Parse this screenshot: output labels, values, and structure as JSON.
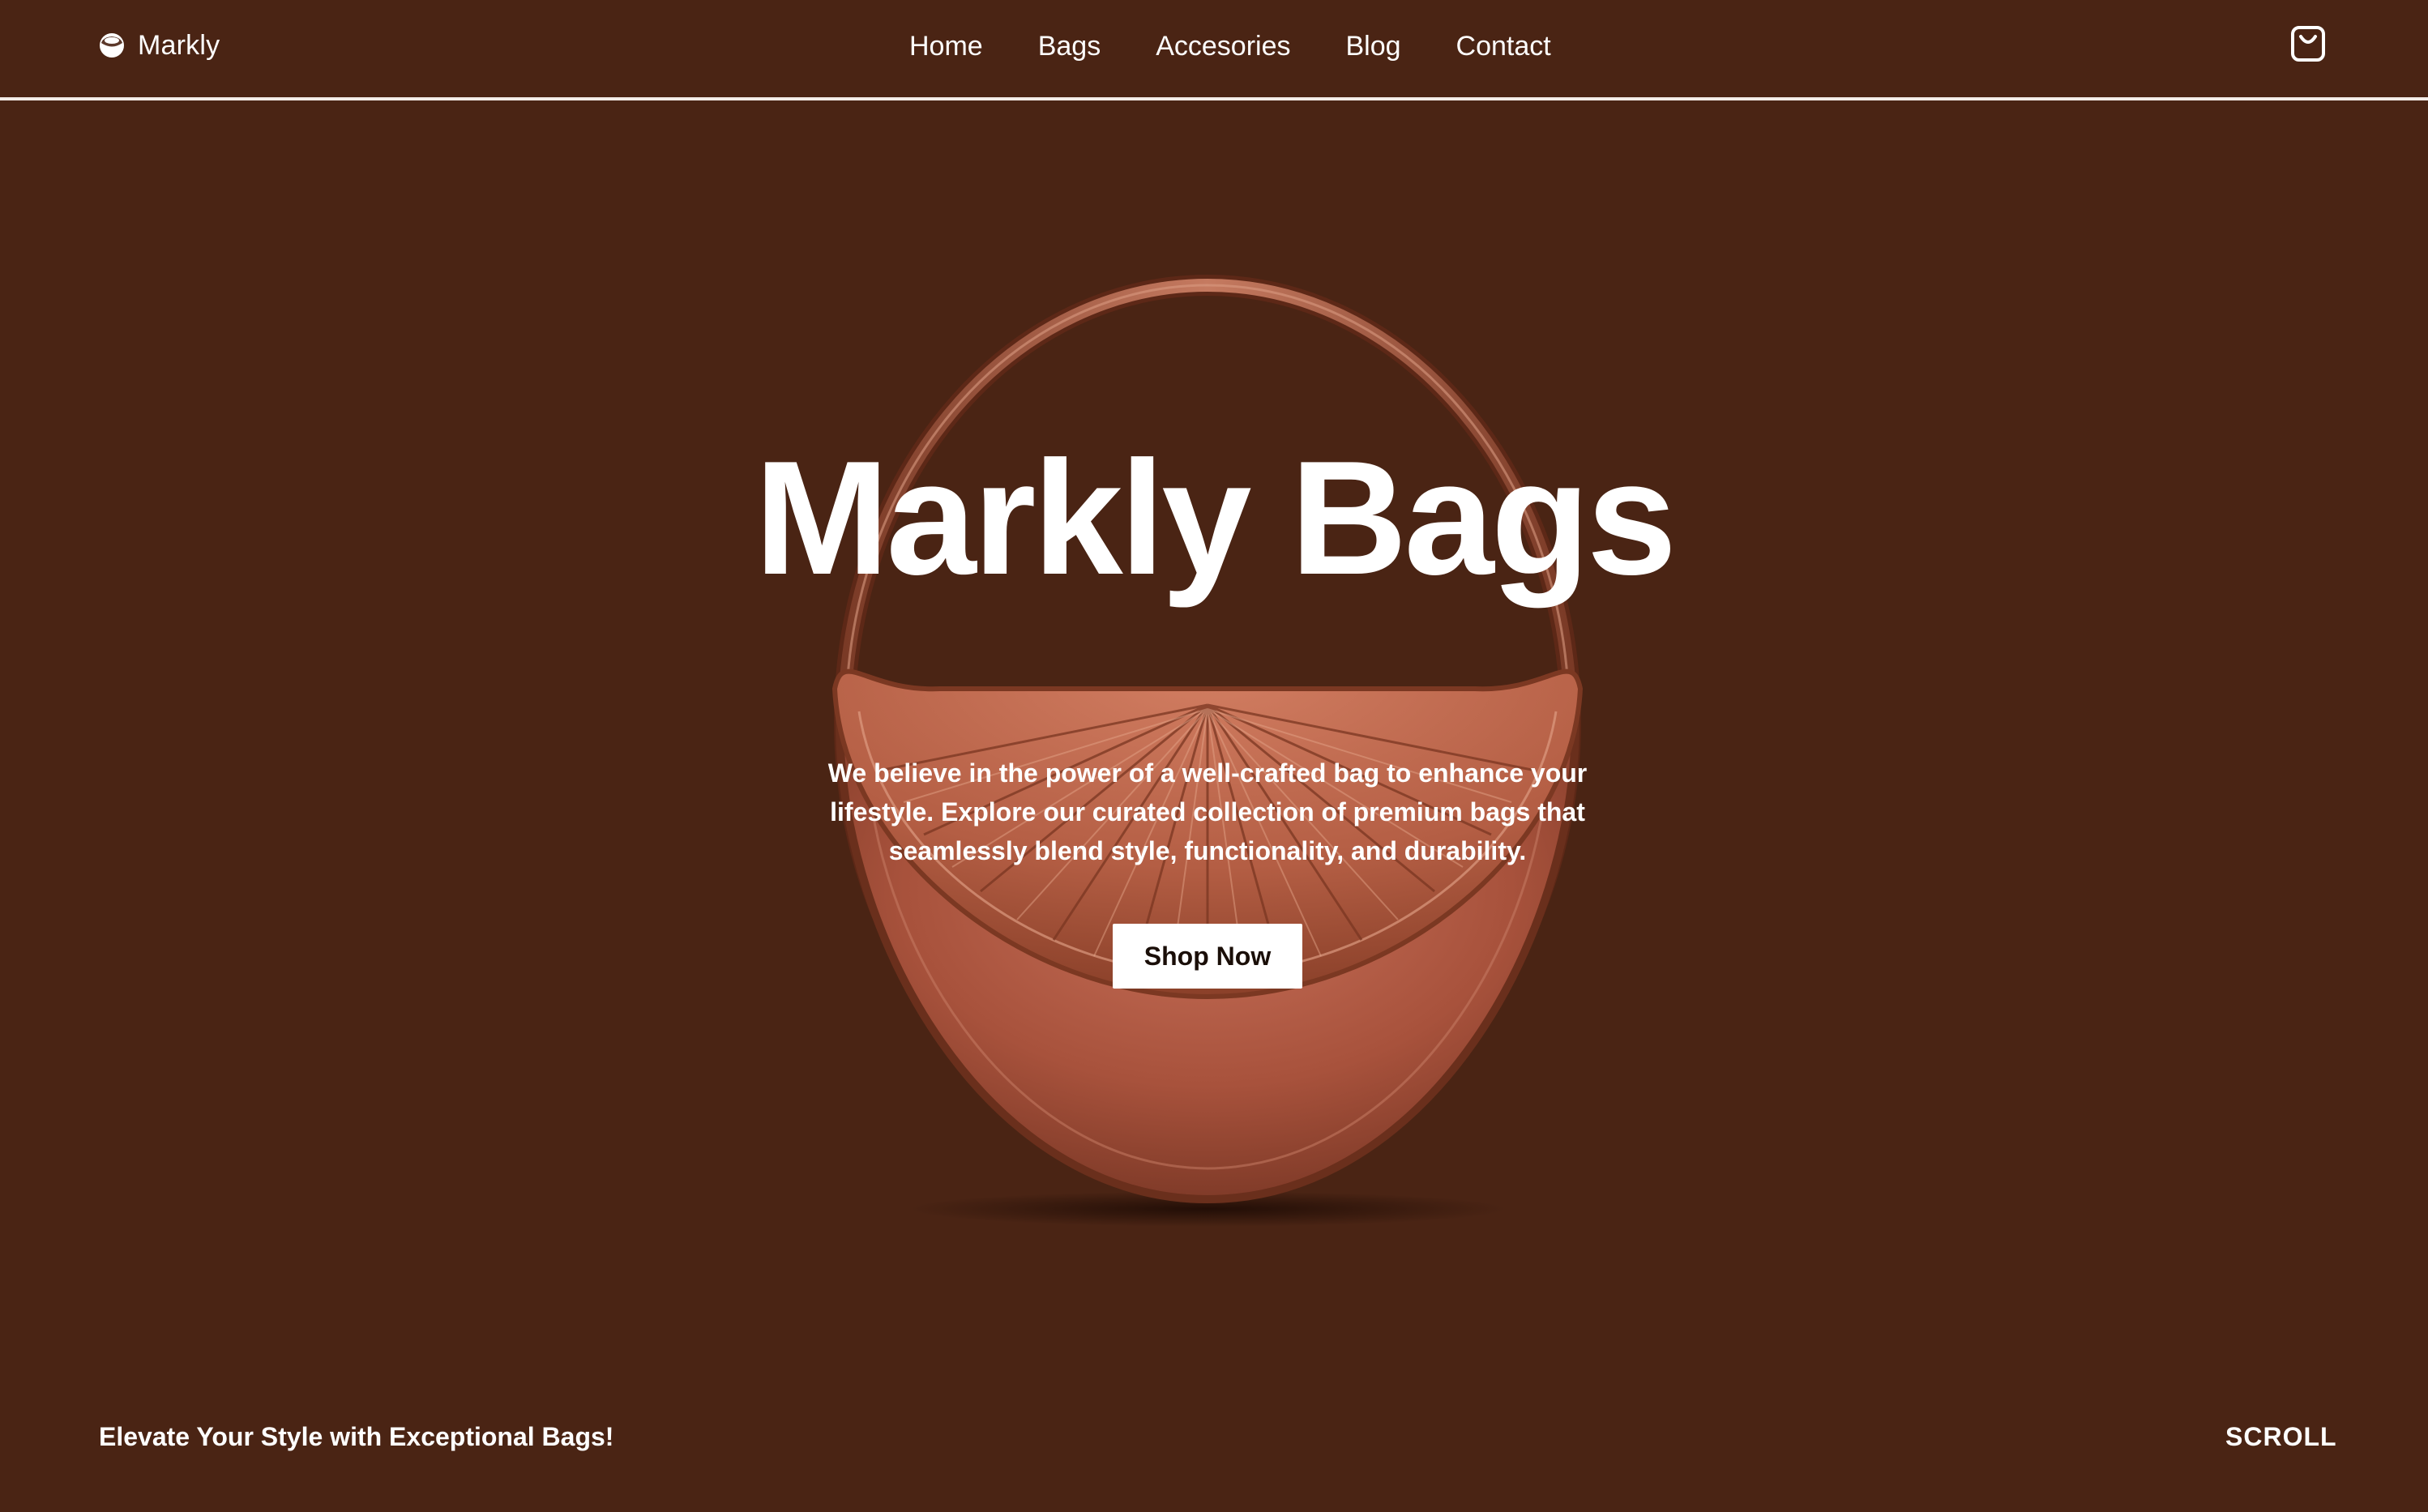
{
  "brand": {
    "name": "Markly",
    "icon": "circle-logo-icon"
  },
  "nav": {
    "items": [
      {
        "label": "Home"
      },
      {
        "label": "Bags"
      },
      {
        "label": "Accesories"
      },
      {
        "label": "Blog"
      },
      {
        "label": "Contact"
      }
    ],
    "cart_icon": "shopping-bag-icon"
  },
  "hero": {
    "title": "Markly Bags",
    "description": "We believe in the power of a well-crafted bag to enhance your lifestyle. Explore our curated collection of premium bags that seamlessly blend style, functionality, and durability.",
    "cta_label": "Shop Now",
    "image": "round-satin-handbag"
  },
  "footer": {
    "tagline": "Elevate Your Style with Exceptional Bags!",
    "scroll_label": "SCROLL"
  },
  "colors": {
    "background": "#4a2414",
    "text": "#ffffff",
    "bag": "#b0583f",
    "button_bg": "#ffffff",
    "button_text": "#1a0e08"
  }
}
